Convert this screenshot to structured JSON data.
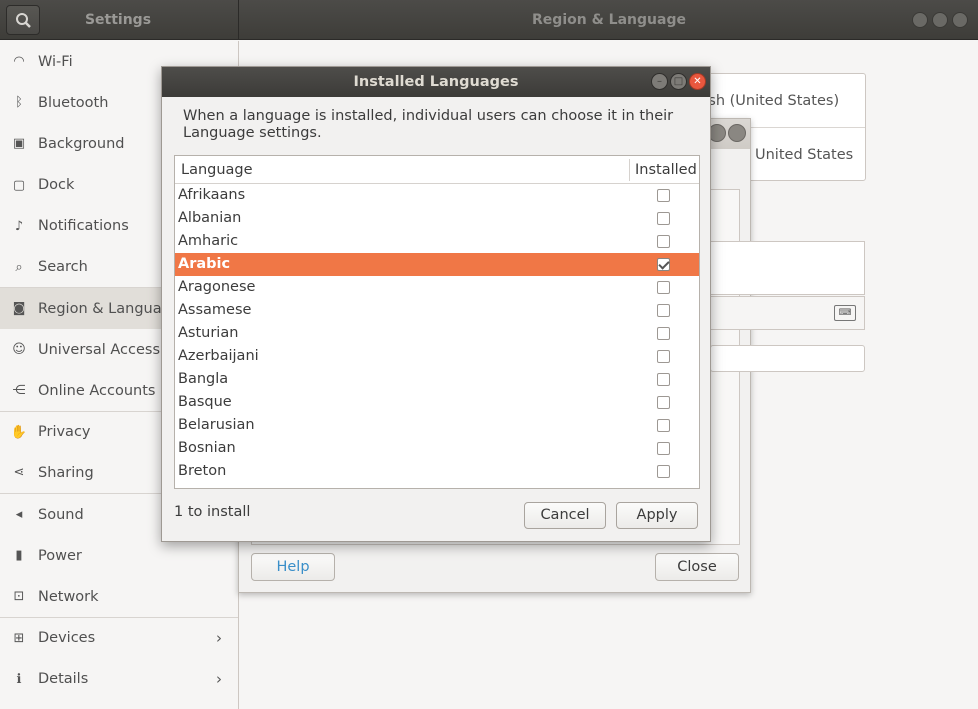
{
  "header": {
    "left_title": "Settings",
    "title": "Region & Language"
  },
  "sidebar": {
    "items": [
      {
        "label": "Wi-Fi",
        "icon": "wifi-icon",
        "glyph": "◠"
      },
      {
        "label": "Bluetooth",
        "icon": "bluetooth-icon",
        "glyph": "ᛒ"
      },
      {
        "label": "Background",
        "icon": "background-icon",
        "glyph": "▣"
      },
      {
        "label": "Dock",
        "icon": "dock-icon",
        "glyph": "▢"
      },
      {
        "label": "Notifications",
        "icon": "bell-icon",
        "glyph": "♪"
      },
      {
        "label": "Search",
        "icon": "search-icon",
        "glyph": "⌕"
      },
      {
        "label": "Region & Language",
        "icon": "camera-icon",
        "glyph": "◙"
      },
      {
        "label": "Universal Access",
        "icon": "accessibility-icon",
        "glyph": "☺"
      },
      {
        "label": "Online Accounts",
        "icon": "online-accounts-icon",
        "glyph": "⋲"
      },
      {
        "label": "Privacy",
        "icon": "hand-icon",
        "glyph": "✋"
      },
      {
        "label": "Sharing",
        "icon": "share-icon",
        "glyph": "⋖"
      },
      {
        "label": "Sound",
        "icon": "speaker-icon",
        "glyph": "◂"
      },
      {
        "label": "Power",
        "icon": "battery-icon",
        "glyph": "▮"
      },
      {
        "label": "Network",
        "icon": "network-icon",
        "glyph": "⊡"
      },
      {
        "label": "Devices",
        "icon": "devices-icon",
        "glyph": "⊞"
      },
      {
        "label": "Details",
        "icon": "info-icon",
        "glyph": "ℹ"
      }
    ]
  },
  "main": {
    "language_value": "glish (United States)",
    "formats_value": "United States"
  },
  "language_dialog": {
    "help_label": "Help",
    "close_label": "Close"
  },
  "installed_dialog": {
    "title": "Installed Languages",
    "description": "When a language is installed, individual users can choose it in their Language settings.",
    "column_language": "Language",
    "column_installed": "Installed",
    "rows": [
      {
        "name": "Afrikaans",
        "installed": false
      },
      {
        "name": "Albanian",
        "installed": false
      },
      {
        "name": "Amharic",
        "installed": false
      },
      {
        "name": "Arabic",
        "installed": true
      },
      {
        "name": "Aragonese",
        "installed": false
      },
      {
        "name": "Assamese",
        "installed": false
      },
      {
        "name": "Asturian",
        "installed": false
      },
      {
        "name": "Azerbaijani",
        "installed": false
      },
      {
        "name": "Bangla",
        "installed": false
      },
      {
        "name": "Basque",
        "installed": false
      },
      {
        "name": "Belarusian",
        "installed": false
      },
      {
        "name": "Bosnian",
        "installed": false
      },
      {
        "name": "Breton",
        "installed": false
      }
    ],
    "selected_index": 3,
    "status": "1 to install",
    "cancel_label": "Cancel",
    "apply_label": "Apply"
  }
}
